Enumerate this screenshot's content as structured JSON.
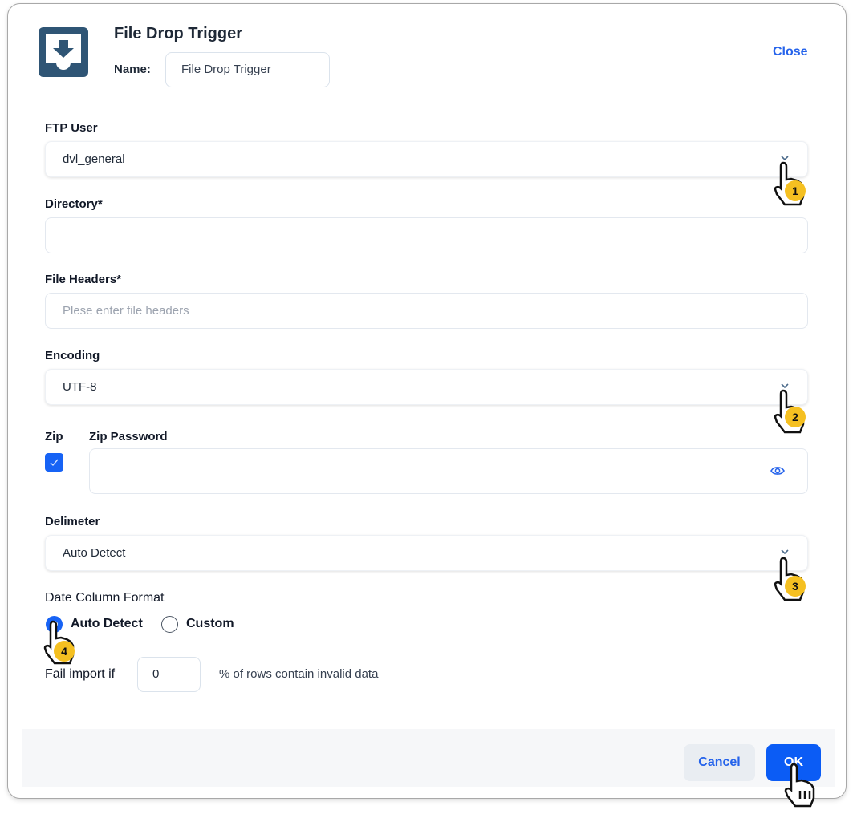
{
  "header": {
    "icon": "file-drop-tray-icon",
    "title": "File Drop Trigger",
    "name_label": "Name:",
    "name_value": "File Drop Trigger",
    "close_label": "Close"
  },
  "form": {
    "ftp_user": {
      "label": "FTP User",
      "value": "dvl_general"
    },
    "directory": {
      "label": "Directory*",
      "value": ""
    },
    "file_headers": {
      "label": "File Headers*",
      "value": "",
      "placeholder": "Plese enter file headers"
    },
    "encoding": {
      "label": "Encoding",
      "value": "UTF-8"
    },
    "zip": {
      "label": "Zip",
      "checked": true
    },
    "zip_password": {
      "label": "Zip Password",
      "value": ""
    },
    "delimeter": {
      "label": "Delimeter",
      "value": "Auto Detect"
    },
    "date_column_format": {
      "label": "Date Column Format",
      "options": [
        "Auto Detect",
        "Custom"
      ],
      "selected": "Auto Detect"
    },
    "fail_import": {
      "label": "Fail import if",
      "value": "0",
      "suffix": "% of rows contain invalid data"
    }
  },
  "footer": {
    "cancel_label": "Cancel",
    "ok_label": "OK"
  },
  "annotations": {
    "steps": [
      "1",
      "2",
      "3",
      "4"
    ]
  },
  "colors": {
    "accent": "#1763f5",
    "icon_bg": "#2f5575",
    "step_badge": "#f5c021"
  }
}
